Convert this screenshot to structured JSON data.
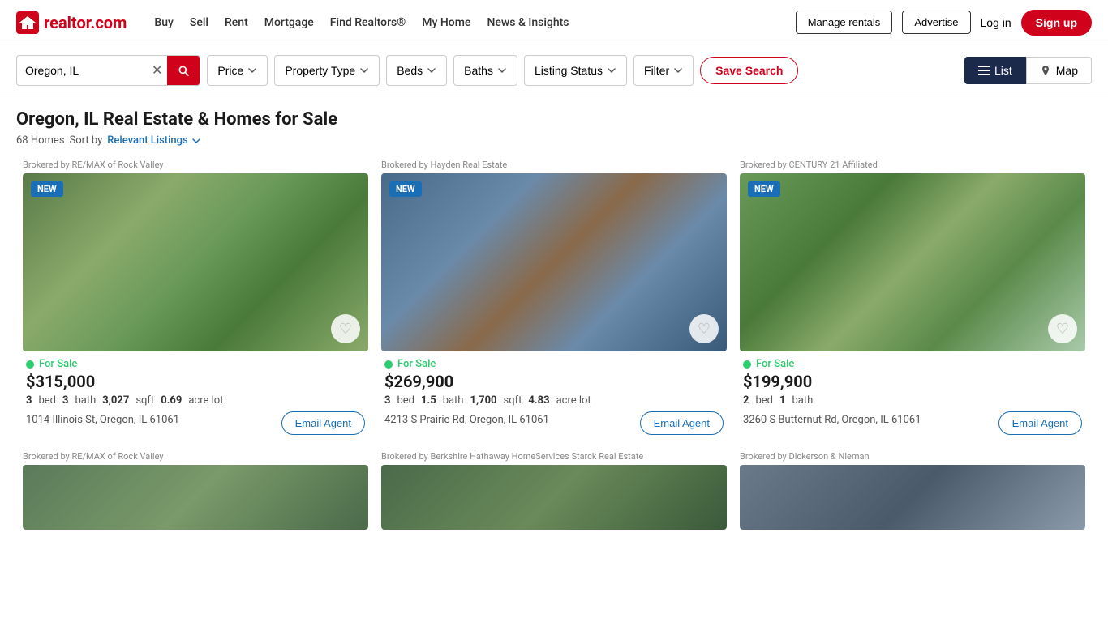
{
  "site": {
    "logo_text": "realtor.com",
    "logo_icon": "🏠"
  },
  "nav": {
    "links": [
      {
        "label": "Buy",
        "id": "buy"
      },
      {
        "label": "Sell",
        "id": "sell"
      },
      {
        "label": "Rent",
        "id": "rent"
      },
      {
        "label": "Mortgage",
        "id": "mortgage"
      },
      {
        "label": "Find Realtors®",
        "id": "find-realtors"
      },
      {
        "label": "My Home",
        "id": "my-home"
      },
      {
        "label": "News & Insights",
        "id": "news-insights"
      }
    ],
    "manage_rentals": "Manage rentals",
    "advertise": "Advertise",
    "login": "Log in",
    "signup": "Sign up"
  },
  "search_bar": {
    "location_value": "Oregon, IL",
    "price_label": "Price",
    "property_type_label": "Property Type",
    "beds_label": "Beds",
    "baths_label": "Baths",
    "listing_status_label": "Listing Status",
    "filter_label": "Filter",
    "save_search_label": "Save Search",
    "list_label": "List",
    "map_label": "Map"
  },
  "page": {
    "title": "Oregon, IL Real Estate & Homes for Sale",
    "count": "68 Homes",
    "sort_prefix": "Sort by",
    "sort_label": "Relevant Listings"
  },
  "listings": [
    {
      "broker": "Brokered by RE/MAX of Rock Valley",
      "badge": "NEW",
      "status": "For Sale",
      "price": "$315,000",
      "beds": "3",
      "beds_label": "bed",
      "baths": "3",
      "baths_label": "bath",
      "sqft": "3,027",
      "sqft_label": "sqft",
      "lot": "0.69",
      "lot_label": "acre lot",
      "address1": "1014 Illinois St,",
      "address2": "Oregon, IL 61061",
      "email_btn": "Email Agent",
      "img_class": "img-1"
    },
    {
      "broker": "Brokered by Hayden Real Estate",
      "badge": "NEW",
      "status": "For Sale",
      "price": "$269,900",
      "beds": "3",
      "beds_label": "bed",
      "baths": "1.5",
      "baths_label": "bath",
      "sqft": "1,700",
      "sqft_label": "sqft",
      "lot": "4.83",
      "lot_label": "acre lot",
      "address1": "4213 S Prairie Rd,",
      "address2": "Oregon, IL 61061",
      "email_btn": "Email Agent",
      "img_class": "img-2"
    },
    {
      "broker": "Brokered by CENTURY 21 Affiliated",
      "badge": "NEW",
      "status": "For Sale",
      "price": "$199,900",
      "beds": "2",
      "beds_label": "bed",
      "baths": "1",
      "baths_label": "bath",
      "sqft": "",
      "sqft_label": "",
      "lot": "",
      "lot_label": "",
      "address1": "3260 S Butternut Rd,",
      "address2": "Oregon, IL 61061",
      "email_btn": "Email Agent",
      "img_class": "img-3"
    }
  ],
  "bottom_listings": [
    {
      "broker": "Brokered by RE/MAX of Rock Valley",
      "img_class": "img-b1"
    },
    {
      "broker": "Brokered by Berkshire Hathaway HomeServices Starck Real Estate",
      "img_class": "img-b2"
    },
    {
      "broker": "Brokered by Dickerson & Nieman",
      "img_class": "img-b3"
    }
  ]
}
